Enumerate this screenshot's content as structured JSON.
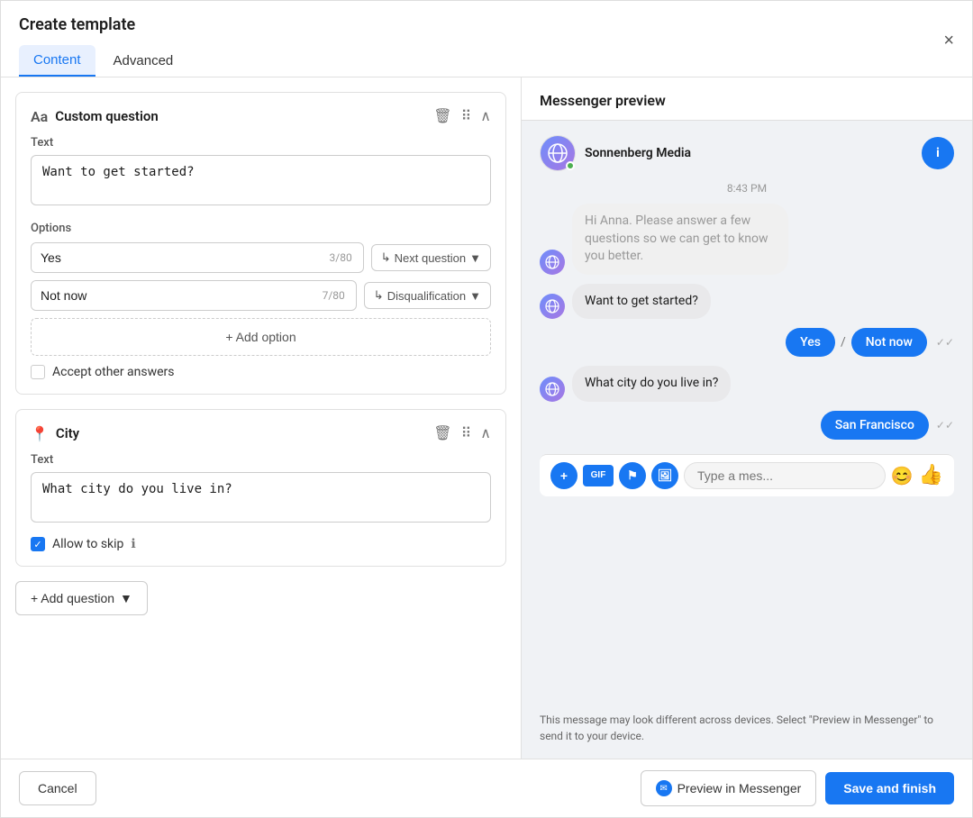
{
  "modal": {
    "title": "Create template",
    "close_label": "×"
  },
  "tabs": [
    {
      "id": "content",
      "label": "Content",
      "active": true
    },
    {
      "id": "advanced",
      "label": "Advanced",
      "active": false
    }
  ],
  "custom_question": {
    "header_icon": "Aa",
    "title": "Custom question",
    "text_label": "Text",
    "text_value": "Want to get started?",
    "options_label": "Options",
    "options": [
      {
        "value": "Yes",
        "char_count": "3/80",
        "action": "Next question"
      },
      {
        "value": "Not now",
        "char_count": "7/80",
        "action": "Disqualification"
      }
    ],
    "add_option_label": "+ Add option",
    "accept_other_answers_label": "Accept other answers"
  },
  "city_question": {
    "title": "City",
    "text_label": "Text",
    "text_value": "What city do you live in?",
    "allow_to_skip_label": "Allow to skip",
    "allow_to_skip_checked": true,
    "info_tooltip": "ℹ"
  },
  "add_question": {
    "label": "+ Add question"
  },
  "messenger_preview": {
    "title": "Messenger preview",
    "brand_name": "Sonnenberg Media",
    "timestamp": "8:43 PM",
    "messages": [
      {
        "type": "bot_intro",
        "text": "Hi Anna. Please answer a few questions so we can get to know you better."
      },
      {
        "type": "bot",
        "text": "Want to get started?"
      },
      {
        "type": "user_options",
        "options": [
          "Yes",
          "Not now"
        ]
      },
      {
        "type": "bot",
        "text": "What city do you live in?"
      },
      {
        "type": "user",
        "text": "San Francisco"
      }
    ],
    "input_placeholder": "Type a mes...",
    "preview_note": "This message may look different across devices. Select \"Preview in Messenger\" to send it to your device."
  },
  "footer": {
    "cancel_label": "Cancel",
    "preview_messenger_label": "Preview in Messenger",
    "save_label": "Save and finish"
  }
}
